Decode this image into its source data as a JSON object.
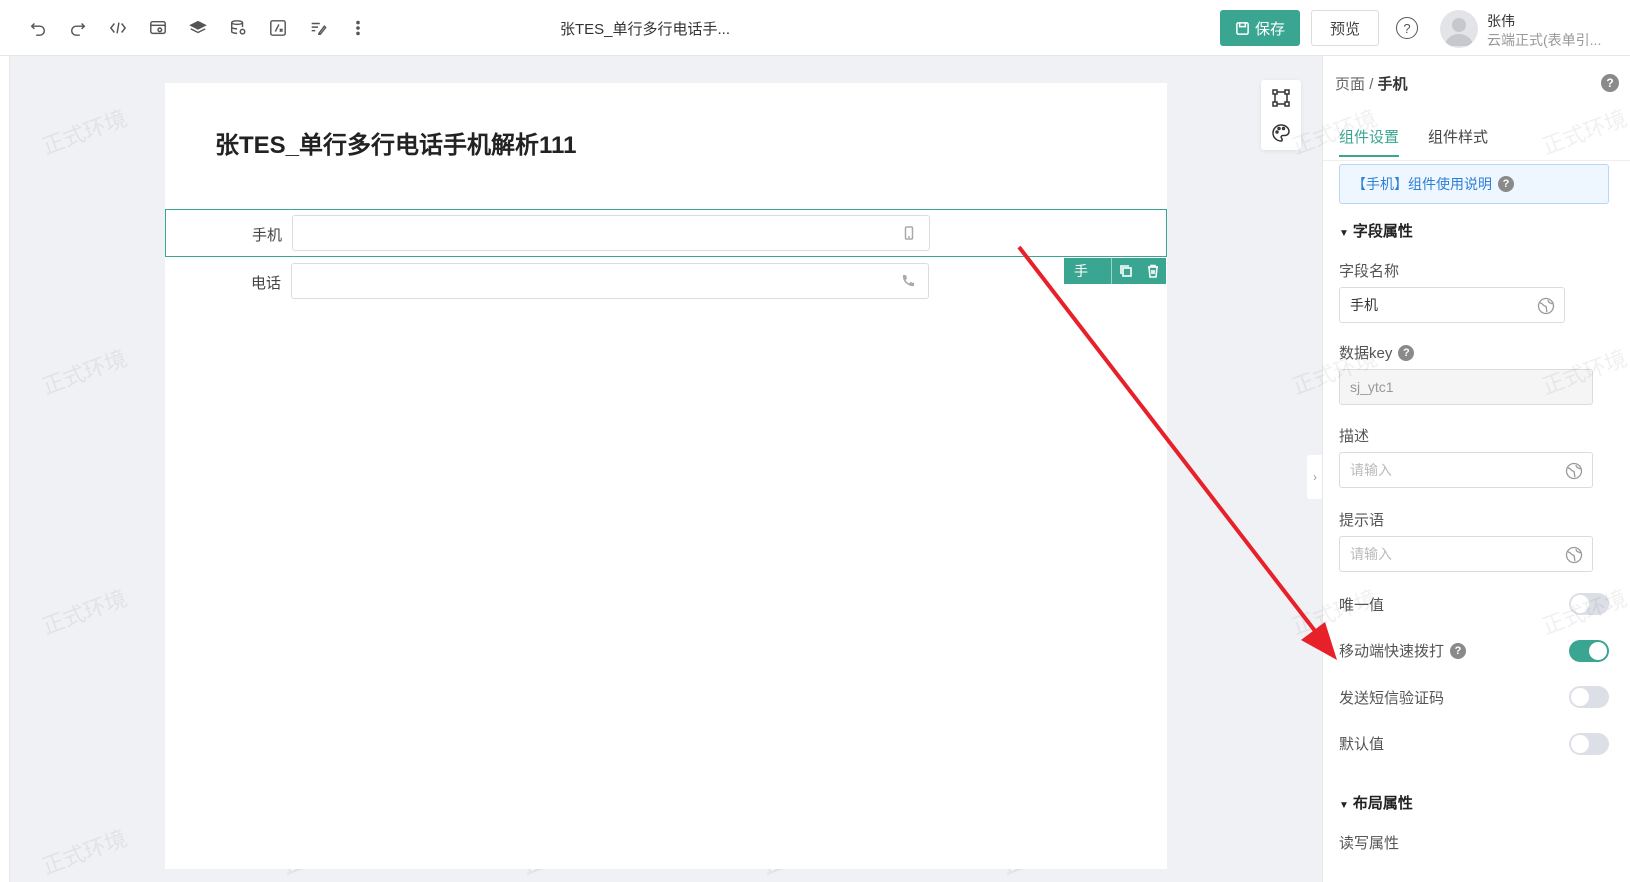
{
  "toolbar": {
    "icons": [
      "undo-icon",
      "redo-icon",
      "code-icon",
      "preview-data-icon",
      "layers-icon",
      "database-icon",
      "formula-icon",
      "form-edit-icon",
      "more-icon"
    ],
    "doc_title": "张TES_单行多行电话手...",
    "save_label": "保存",
    "preview_label": "预览",
    "help_label": "?"
  },
  "user": {
    "name": "张伟",
    "org": "云端正式(表单引..."
  },
  "canvas": {
    "form_title": "张TES_单行多行电话手机解析111",
    "fields": [
      {
        "label": "手机",
        "value": "",
        "icon": "mobile-icon"
      },
      {
        "label": "电话",
        "value": "",
        "icon": "phone-icon"
      }
    ],
    "selection_tag": "手机",
    "watermark": "正式环境"
  },
  "panel": {
    "breadcrumb_root": "页面",
    "breadcrumb_sep": "/",
    "breadcrumb_current": "手机",
    "tabs": [
      "组件设置",
      "组件样式"
    ],
    "usage_note": "【手机】组件使用说明",
    "section_field": "字段属性",
    "field_name_label": "字段名称",
    "field_name_value": "手机",
    "data_key_label": "数据key",
    "data_key_value": "sj_ytc1",
    "desc_label": "描述",
    "desc_placeholder": "请输入",
    "hint_label": "提示语",
    "hint_placeholder": "请输入",
    "unique_label": "唯一值",
    "quick_dial_label": "移动端快速拨打",
    "sms_label": "发送短信验证码",
    "default_label": "默认值",
    "section_layout": "布局属性",
    "rw_label": "读写属性",
    "switches": {
      "unique": false,
      "quick_dial": true,
      "sms": false,
      "default": false
    }
  },
  "colors": {
    "accent": "#3aa692",
    "annotation_arrow": "#e8202a",
    "info_blue": "#2f7fd6"
  }
}
